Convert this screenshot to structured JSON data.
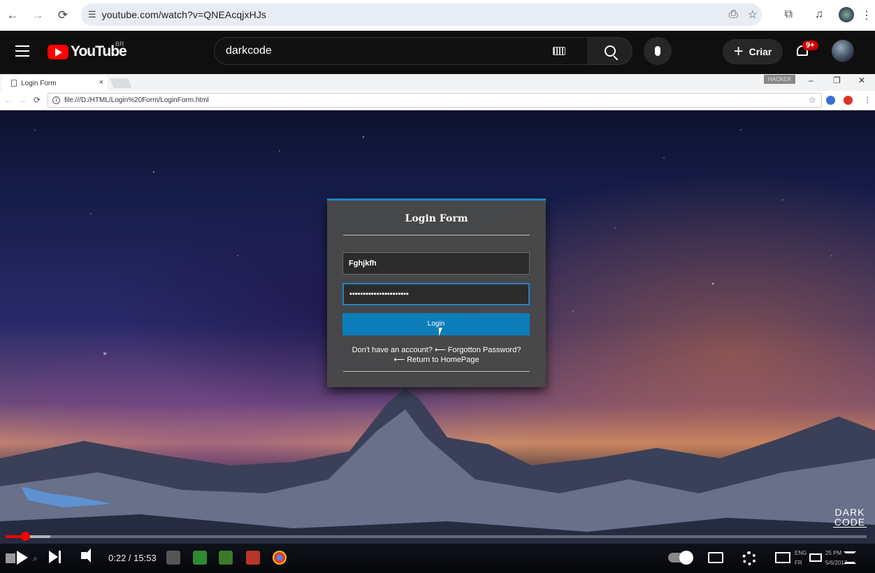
{
  "browser": {
    "url": "youtube.com/watch?v=QNEAcqjxHJs"
  },
  "youtube": {
    "logo_text": "YouTube",
    "region": "BR",
    "search_query": "darkcode",
    "create_label": "Criar",
    "notifications_badge": "9+"
  },
  "inner_browser": {
    "tab_title": "Login Form",
    "tab_close": "×",
    "url": "file:///D:/HTML/Login%20Form/LoginForm.html",
    "watermark_tag": "HACKER"
  },
  "login_form": {
    "title": "Login Form",
    "username_value": "Fghjkfh",
    "password_value": "••••••••••••••••••••••",
    "login_label": "Login",
    "link_line1": "Don't have an account? ⟵ Forgotton Password?",
    "link_line2": "⟵ Return to HomePage"
  },
  "player": {
    "current_time": "0:22",
    "duration": "15:53",
    "time_display": "0:22 / 15:53",
    "progress_fraction": 0.023,
    "channel_watermark": "DARK CODE",
    "taskbar_lang_1": "ENG",
    "taskbar_lang_2": "FR",
    "taskbar_time": "25 PM",
    "taskbar_date": "5/6/2017"
  },
  "colors": {
    "yt_red": "#ff0000",
    "accent_blue": "#0c7db8",
    "form_bg": "#484848"
  }
}
